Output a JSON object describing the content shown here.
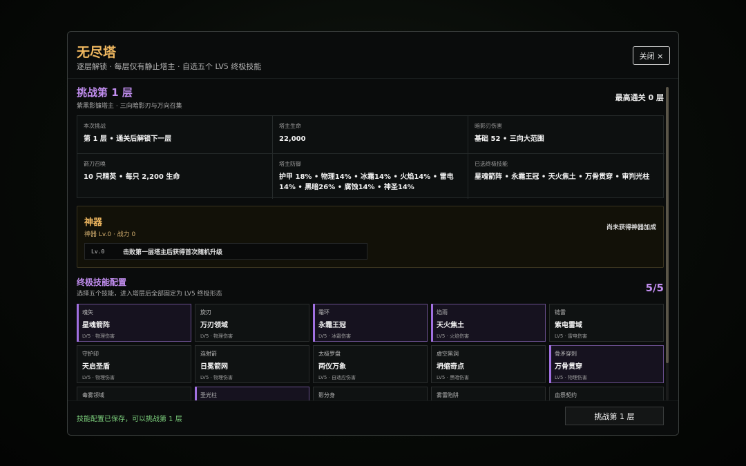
{
  "header": {
    "title": "无尽塔",
    "subtitle": "逐层解锁 · 每层仅有静止塔主 · 自选五个 LV5 终极技能",
    "close_label": "关闭 ×"
  },
  "challenge": {
    "title": "挑战第 1 层",
    "subtitle": "紫黑影镰塔主 · 三向暗影刃与万向召集",
    "best_record": "最高通关 0 层"
  },
  "info": [
    {
      "label": "本次挑战",
      "value": "第 1 层 • 通关后解锁下一层"
    },
    {
      "label": "塔主生命",
      "value": "22,000"
    },
    {
      "label": "暗影刃伤害",
      "value": "基础 52 • 三向大范围"
    },
    {
      "label": "箭刀召唤",
      "value": "10 只精英 • 每只 2,200 生命"
    },
    {
      "label": "塔主防御",
      "value": "护甲 18% • 物理14% • 冰霜14% • 火焰14% • 雷电 14% • 黑暗26% • 腐蚀14% • 神圣14%"
    },
    {
      "label": "已选终极技能",
      "value": "星魂箭阵 • 永霜王冠 • 天火焦土 • 万骨贯穿 • 审判光柱"
    }
  ],
  "artifact": {
    "title": "神器",
    "subtitle": "神器 Lv.0 · 战力 0",
    "note": "尚未获得神器加成",
    "slot_level": "Lv.0",
    "slot_text": "击败第一层塔主后获得首次随机升级"
  },
  "skills_section": {
    "title": "终极技能配置",
    "subtitle": "选择五个技能，进入塔层后全部固定为 LV5 终极形态",
    "count": "5/5"
  },
  "skills": [
    {
      "name": "魂矢",
      "form": "星魂箭阵",
      "meta": "LV5 · 物理伤害",
      "selected": true
    },
    {
      "name": "旋刃",
      "form": "万刃领域",
      "meta": "LV5 · 物理伤害",
      "selected": false
    },
    {
      "name": "霜环",
      "form": "永霜王冠",
      "meta": "LV5 · 冰霜伤害",
      "selected": true
    },
    {
      "name": "焰雨",
      "form": "天火焦土",
      "meta": "LV5 · 火焰伤害",
      "selected": true
    },
    {
      "name": "链雷",
      "form": "紫电雷域",
      "meta": "LV5 · 雷电伤害",
      "selected": false
    },
    {
      "name": "守护印",
      "form": "天启圣盾",
      "meta": "LV5 · 物理伤害",
      "selected": false
    },
    {
      "name": "连射箭",
      "form": "日冕箭网",
      "meta": "LV5 · 物理伤害",
      "selected": false
    },
    {
      "name": "太极罗盘",
      "form": "两仪万象",
      "meta": "LV5 · 自适应伤害",
      "selected": false
    },
    {
      "name": "虚空黑洞",
      "form": "坍缩奇点",
      "meta": "LV5 · 黑暗伤害",
      "selected": false
    },
    {
      "name": "骨矛穿刺",
      "form": "万骨贯穿",
      "meta": "LV5 · 物理伤害",
      "selected": true
    },
    {
      "name": "毒雾领域",
      "form": "",
      "meta": "",
      "selected": false
    },
    {
      "name": "圣光柱",
      "form": "",
      "meta": "",
      "selected": true
    },
    {
      "name": "影分身",
      "form": "",
      "meta": "",
      "selected": false
    },
    {
      "name": "雾雷陷阱",
      "form": "",
      "meta": "",
      "selected": false
    },
    {
      "name": "血祭契约",
      "form": "",
      "meta": "",
      "selected": false
    }
  ],
  "footer": {
    "status": "技能配置已保存，可以挑战第 1 层",
    "challenge_label": "挑战第 1 层"
  },
  "colors": {
    "gold_accent": "#f0b860",
    "purple_accent": "#c28ef0",
    "success_text": "#7ccf7c"
  }
}
